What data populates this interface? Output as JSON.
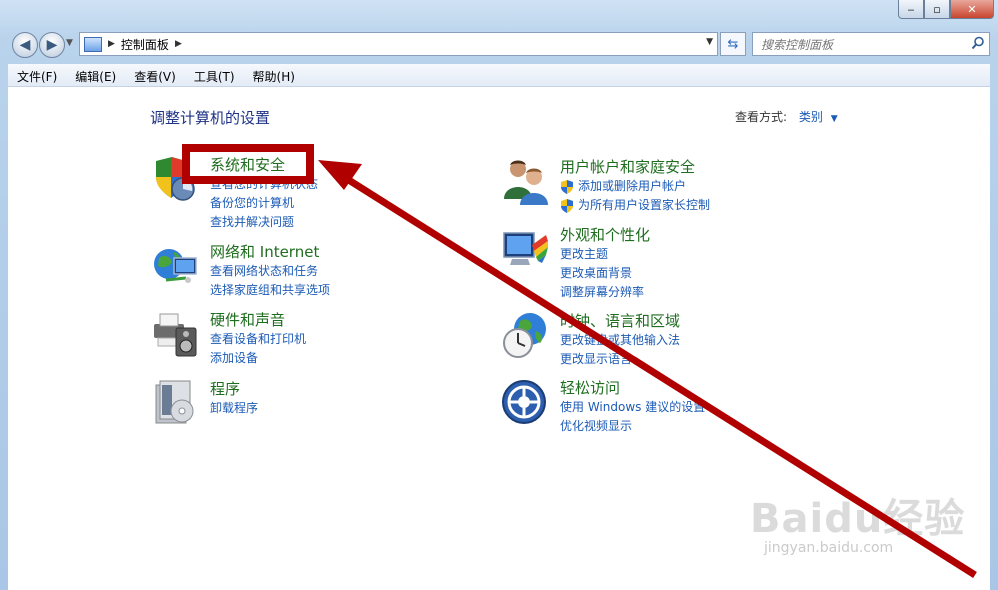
{
  "window": {
    "min_label": "‒",
    "max_label": "▫",
    "close_label": "✕"
  },
  "address": {
    "crumb": "控制面板",
    "search_placeholder": "搜索控制面板"
  },
  "menu": [
    {
      "label": "文件(F)"
    },
    {
      "label": "编辑(E)"
    },
    {
      "label": "查看(V)"
    },
    {
      "label": "工具(T)"
    },
    {
      "label": "帮助(H)"
    }
  ],
  "page": {
    "title": "调整计算机的设置",
    "view_label": "查看方式:",
    "view_value": "类别"
  },
  "categories": [
    {
      "icon": "shield-computer-icon",
      "title": "系统和安全",
      "links": [
        "查看您的计算机状态",
        "备份您的计算机",
        "查找并解决问题"
      ]
    },
    {
      "icon": "network-globe-icon",
      "title": "网络和 Internet",
      "links": [
        "查看网络状态和任务",
        "选择家庭组和共享选项"
      ]
    },
    {
      "icon": "printer-speaker-icon",
      "title": "硬件和声音",
      "links": [
        "查看设备和打印机",
        "添加设备"
      ]
    },
    {
      "icon": "programs-disc-icon",
      "title": "程序",
      "links": [
        "卸载程序"
      ]
    },
    {
      "icon": "users-icon",
      "title": "用户帐户和家庭安全",
      "links": [
        "添加或删除用户帐户",
        "为所有用户设置家长控制"
      ]
    },
    {
      "icon": "monitor-palette-icon",
      "title": "外观和个性化",
      "links": [
        "更改主题",
        "更改桌面背景",
        "调整屏幕分辨率"
      ]
    },
    {
      "icon": "clock-globe-icon",
      "title": "时钟、语言和区域",
      "links": [
        "更改键盘或其他输入法",
        "更改显示语言"
      ]
    },
    {
      "icon": "accessibility-icon",
      "title": "轻松访问",
      "links": [
        "使用 Windows 建议的设置",
        "优化视频显示"
      ]
    }
  ],
  "watermark": {
    "main": "Baidu经验",
    "sub": "jingyan.baidu.com"
  },
  "colors": {
    "link": "#1c5bb5",
    "heading": "#1f6d1f",
    "annotation": "#b00000"
  }
}
